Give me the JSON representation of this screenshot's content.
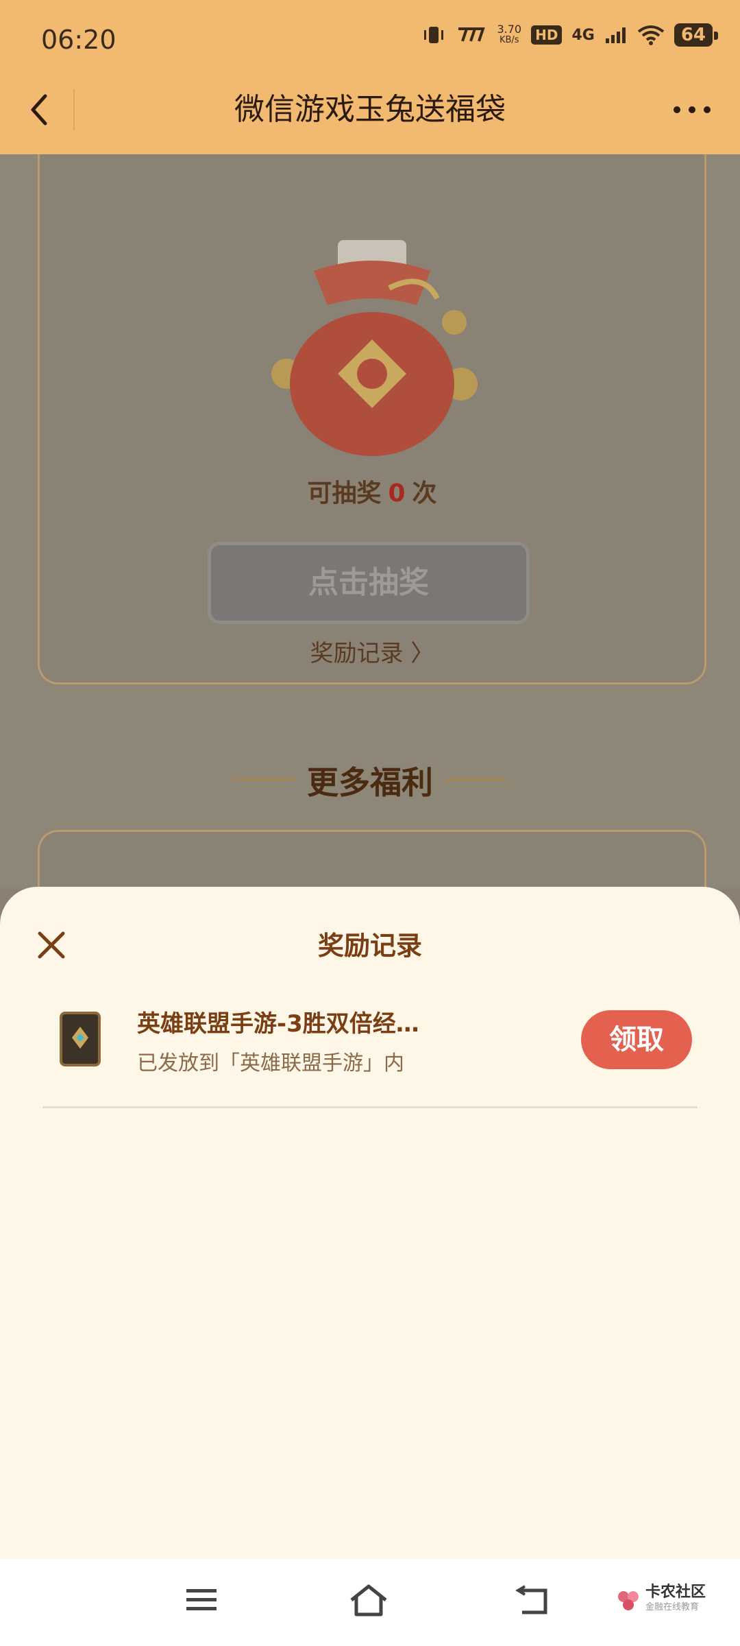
{
  "status_bar": {
    "time": "06:20",
    "speed_value": "3.70",
    "speed_unit": "KB/s",
    "hd": "HD",
    "network": "4G",
    "battery": "64"
  },
  "header": {
    "title": "微信游戏玉兔送福袋"
  },
  "background": {
    "chances_prefix": "可抽奖",
    "chances_count": "0",
    "chances_suffix": "次",
    "draw_button": "点击抽奖",
    "reward_record_link": "奖励记录 〉",
    "more_benefits_title": "更多福利"
  },
  "sheet": {
    "title": "奖励记录",
    "items": [
      {
        "title": "英雄联盟手游-3胜双倍经…",
        "subtitle": "已发放到「英雄联盟手游」内",
        "action": "领取"
      }
    ]
  },
  "watermark": {
    "name": "卡农社区",
    "slogan": "金融在线教育"
  },
  "colors": {
    "header_bg": "#f2b970",
    "sheet_bg": "#fef6e7",
    "claim_button": "#e4604f",
    "title_brown": "#7a3e14"
  }
}
